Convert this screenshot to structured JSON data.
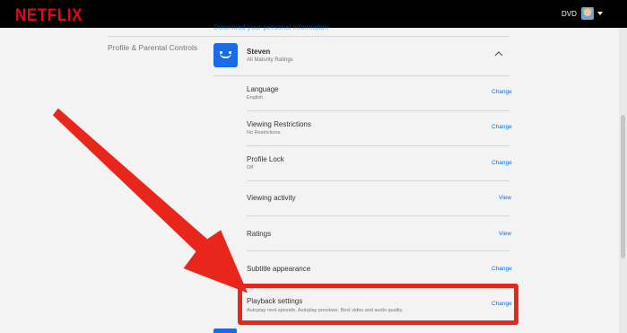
{
  "header": {
    "logo_text": "NETFLIX",
    "account_label": "DVD"
  },
  "cutoff_link": "Download your personal information",
  "section": {
    "label": "Profile & Parental Controls"
  },
  "profile": {
    "name": "Steven",
    "subtitle": "All Maturity Ratings"
  },
  "settings": [
    {
      "title": "Language",
      "value": "English",
      "action": "Change"
    },
    {
      "title": "Viewing Restrictions",
      "value": "No Restrictions.",
      "action": "Change"
    },
    {
      "title": "Profile Lock",
      "value": "Off",
      "action": "Change"
    },
    {
      "title": "Viewing activity",
      "value": "",
      "action": "View"
    },
    {
      "title": "Ratings",
      "value": "",
      "action": "View"
    },
    {
      "title": "Subtitle appearance",
      "value": "",
      "action": "Change"
    },
    {
      "title": "Playback settings",
      "value": "Autoplay next episode. Autoplay previews. Best video and audio quality.",
      "action": "Change"
    }
  ],
  "colors": {
    "brand_red": "#e50914",
    "link_blue": "#0073e6",
    "annotation_red": "#e8261c",
    "profile_blue": "#1a6be8"
  }
}
